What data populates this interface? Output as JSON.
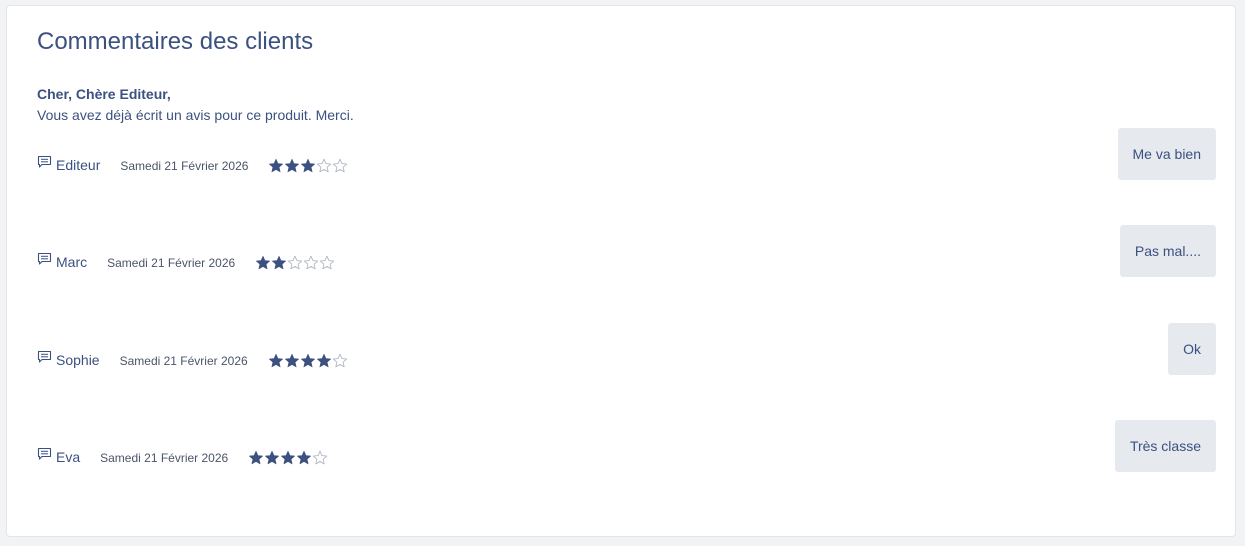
{
  "section": {
    "title": "Commentaires des clients",
    "greeting": "Cher, Chère Editeur,",
    "notice": "Vous avez déjà écrit un avis pour ce produit. Merci."
  },
  "colors": {
    "accent": "#3b5180",
    "star_filled": "#3b5180",
    "star_empty": "#b0b7c3",
    "button_bg": "#e6e9ee"
  },
  "reviews": [
    {
      "author": "Editeur",
      "date": "Samedi 21 Février 2026",
      "rating": 3,
      "max_rating": 5,
      "comment": "Me va bien"
    },
    {
      "author": "Marc",
      "date": "Samedi 21 Février 2026",
      "rating": 2,
      "max_rating": 5,
      "comment": "Pas mal...."
    },
    {
      "author": "Sophie",
      "date": "Samedi 21 Février 2026",
      "rating": 4,
      "max_rating": 5,
      "comment": "Ok"
    },
    {
      "author": "Eva",
      "date": "Samedi 21 Février 2026",
      "rating": 4,
      "max_rating": 5,
      "comment": "Très classe"
    }
  ]
}
